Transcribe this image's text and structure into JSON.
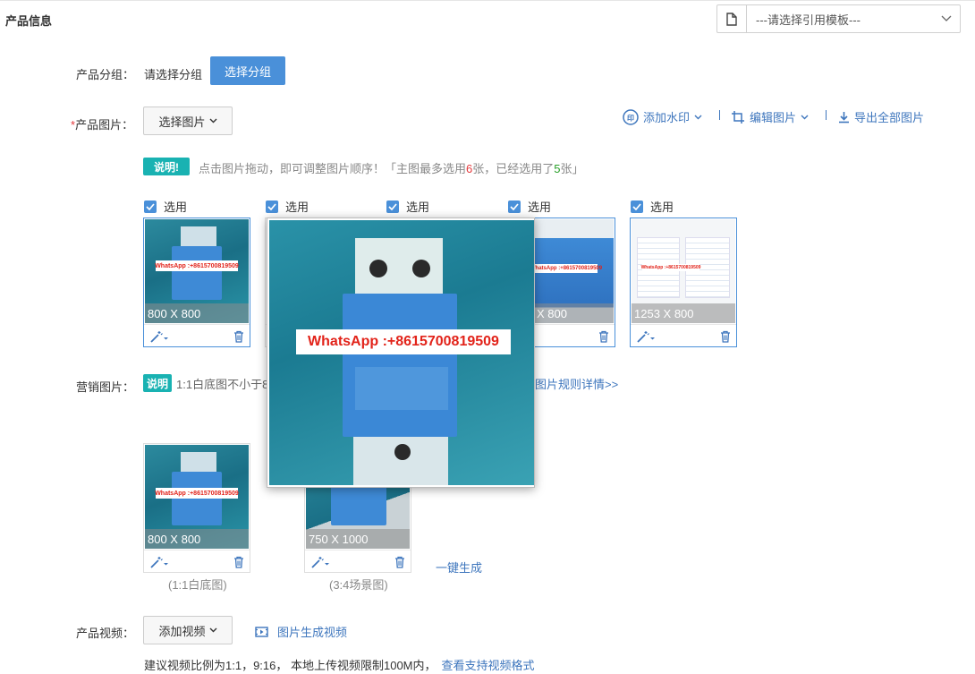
{
  "header": {
    "title": "产品信息",
    "template_placeholder": "---请选择引用模板---"
  },
  "group": {
    "label": "产品分组：",
    "value": "请选择分组",
    "button": "选择分组"
  },
  "images": {
    "required_mark": "*",
    "label": "产品图片：",
    "select_button": "选择图片",
    "tools": {
      "watermark": "添加水印",
      "edit": "编辑图片",
      "export": "导出全部图片"
    },
    "note_badge": "说明!",
    "tip_prefix": "点击图片拖动，即可调整图片顺序！「主图最多选用",
    "tip_max": "6",
    "tip_middle": "张，已经选用了",
    "tip_selected": "5",
    "tip_suffix": "张」",
    "check_label": "选用",
    "cards": [
      {
        "dims": "800 X 800"
      },
      {
        "dims": ""
      },
      {
        "dims": ""
      },
      {
        "dims": "X 800"
      },
      {
        "dims": "1253 X 800"
      }
    ]
  },
  "preview": {
    "watermark": "WhatsApp :+8615700819509"
  },
  "thumb_watermark": "WhatsApp :+8615700819509",
  "marketing": {
    "label": "营销图片：",
    "note_badge": "说明",
    "tip": "1:1白底图不小于8",
    "rules_link": "图片规则详情>>",
    "cards": [
      {
        "dims": "800 X 800",
        "caption": "(1:1白底图)"
      },
      {
        "dims": "750 X 1000",
        "caption": "(3:4场景图)"
      }
    ],
    "generate_link": "一键生成"
  },
  "video": {
    "label": "产品视频：",
    "add_button": "添加视频",
    "generate_link": "图片生成视频",
    "tip": "建议视频比例为1:1，9:16， 本地上传视频限制100M内，",
    "formats_link": "查看支持视频格式"
  },
  "colors": {
    "accent": "#4a90d9",
    "link": "#3e76bd",
    "badge": "#19b2b2",
    "red": "#e4393c",
    "green": "#2aa02a"
  }
}
